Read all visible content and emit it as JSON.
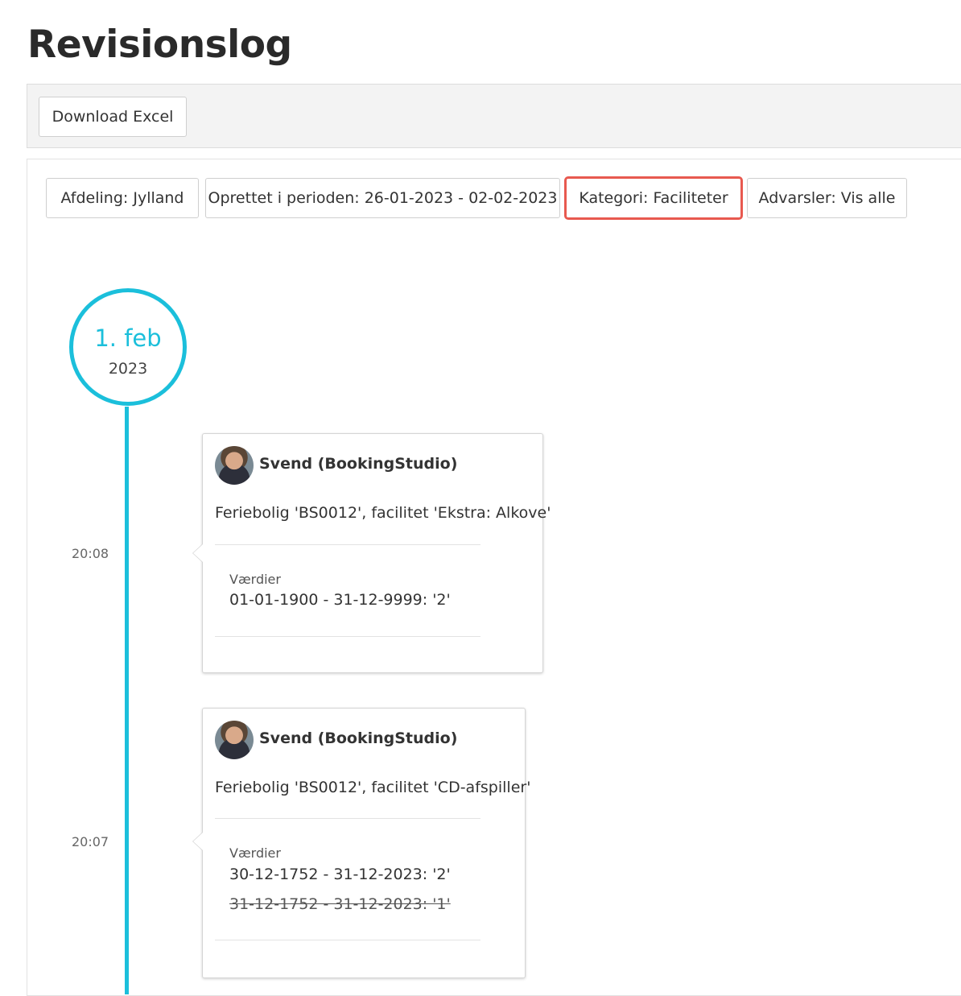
{
  "page": {
    "title": "Revisionslog"
  },
  "toolbar": {
    "download_label": "Download Excel"
  },
  "filters": {
    "department": "Afdeling: Jylland",
    "period": "Oprettet i perioden: 26-01-2023 - 02-02-2023",
    "category": "Kategori: Faciliteter",
    "warnings": "Advarsler: Vis alle"
  },
  "timeline": {
    "date_day": "1. feb",
    "date_year": "2023",
    "entries": [
      {
        "time": "20:08",
        "user": "Svend (BookingStudio)",
        "description": "Feriebolig 'BS0012', facilitet 'Ekstra: Alkove'",
        "values_label": "Værdier",
        "new_value": "01-01-1900 - 31-12-9999: '2'"
      },
      {
        "time": "20:07",
        "user": "Svend (BookingStudio)",
        "description": "Feriebolig 'BS0012', facilitet 'CD-afspiller'",
        "values_label": "Værdier",
        "new_value": "30-12-1752 - 31-12-2023: '2'",
        "old_value": "31-12-1752 - 31-12-2023: '1'"
      }
    ]
  },
  "colors": {
    "accent": "#1bbfdb",
    "highlight": "#e8594f"
  }
}
